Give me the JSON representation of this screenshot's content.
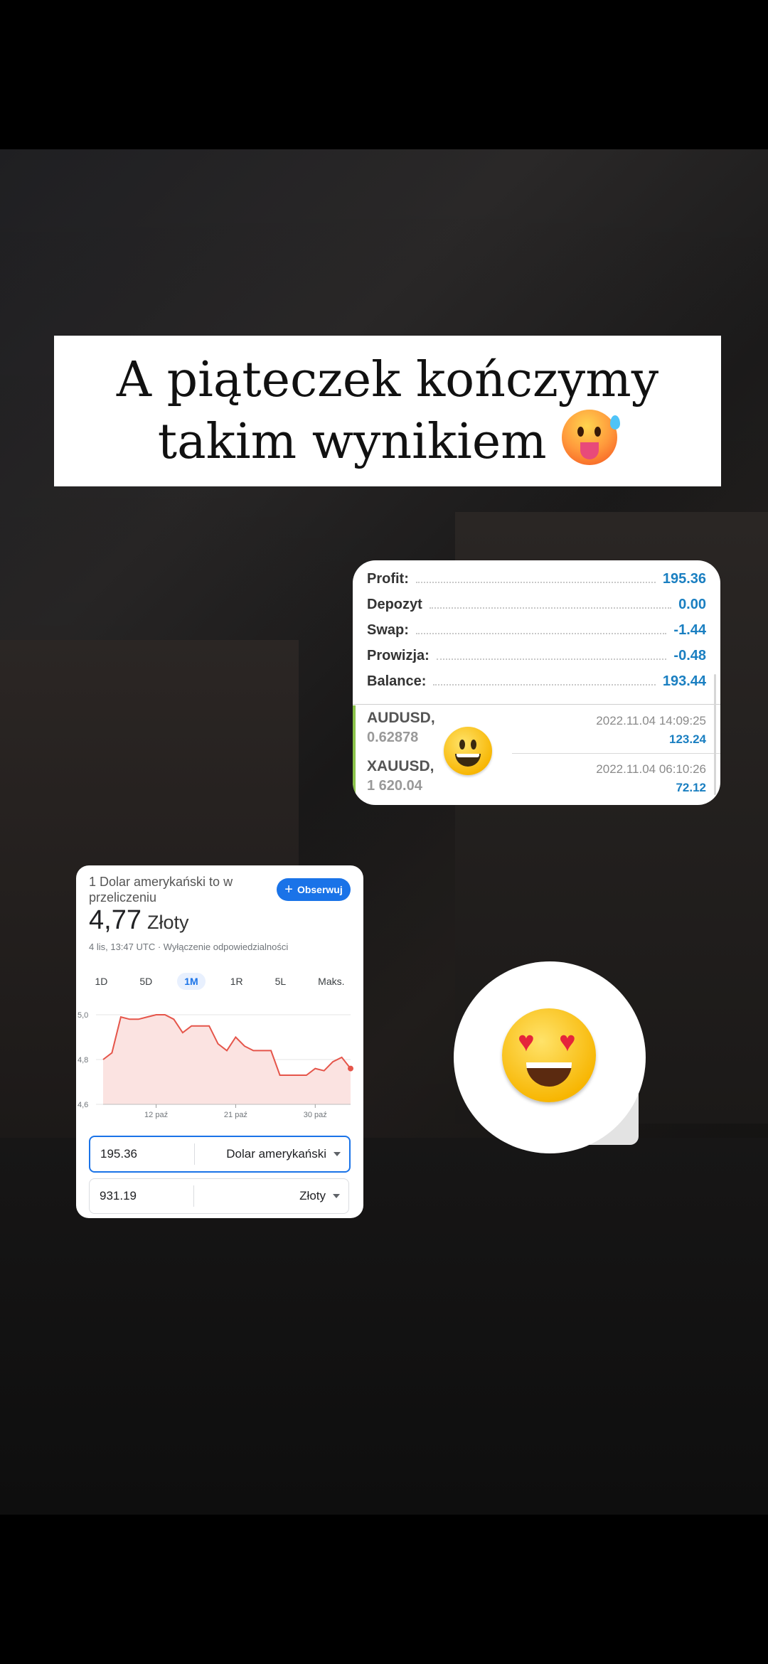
{
  "title": {
    "text": "A piąteczek kończymy takim wynikiem"
  },
  "trade_summary": {
    "rows": [
      {
        "label": "Profit:",
        "value": "195.36"
      },
      {
        "label": "Depozyt",
        "value": "0.00"
      },
      {
        "label": "Swap:",
        "value": "-1.44"
      },
      {
        "label": "Prowizja:",
        "value": "-0.48"
      },
      {
        "label": "Balance:",
        "value": "193.44"
      }
    ],
    "positions": [
      {
        "symbol": "AUDUSD,",
        "price": "0.62878",
        "time": "2022.11.04 14:09:25",
        "pnl": "123.24"
      },
      {
        "symbol": "XAUUSD,",
        "price": "1 620.04",
        "time": "2022.11.04 06:10:26",
        "pnl": "72.12"
      }
    ],
    "accent_color": "#1a7fc1",
    "bar_color": "#8bc34a"
  },
  "fx": {
    "subtitle": "1 Dolar amerykański to w przeliczeniu",
    "follow_label": "Obserwuj",
    "rate": "4,77",
    "currency": "Złoty",
    "note": "4 lis, 13:47 UTC · Wyłączenie odpowiedzialności",
    "tabs": [
      {
        "label": "1D",
        "active": false
      },
      {
        "label": "5D",
        "active": false
      },
      {
        "label": "1M",
        "active": true
      },
      {
        "label": "1R",
        "active": false
      },
      {
        "label": "5L",
        "active": false
      },
      {
        "label": "Maks.",
        "active": false
      }
    ],
    "input_from": {
      "amount": "195.36",
      "unit": "Dolar amerykański"
    },
    "input_to": {
      "amount": "931.19",
      "unit": "Złoty"
    }
  },
  "chart_data": {
    "type": "area",
    "ylim": [
      4.6,
      5.0
    ],
    "y_ticks": [
      "5,0",
      "4,8",
      "4,6"
    ],
    "x_tick_labels": [
      "12 paź",
      "21 paź",
      "30 paź"
    ],
    "x_tick_index": [
      6,
      15,
      24
    ],
    "values": [
      4.8,
      4.83,
      4.99,
      4.98,
      4.98,
      4.99,
      5.0,
      5.0,
      4.98,
      4.92,
      4.95,
      4.95,
      4.95,
      4.87,
      4.84,
      4.9,
      4.86,
      4.84,
      4.84,
      4.84,
      4.73,
      4.73,
      4.73,
      4.73,
      4.76,
      4.75,
      4.79,
      4.81,
      4.76
    ],
    "line_color": "#e5554a",
    "fill_color": "#fbe3e1"
  }
}
